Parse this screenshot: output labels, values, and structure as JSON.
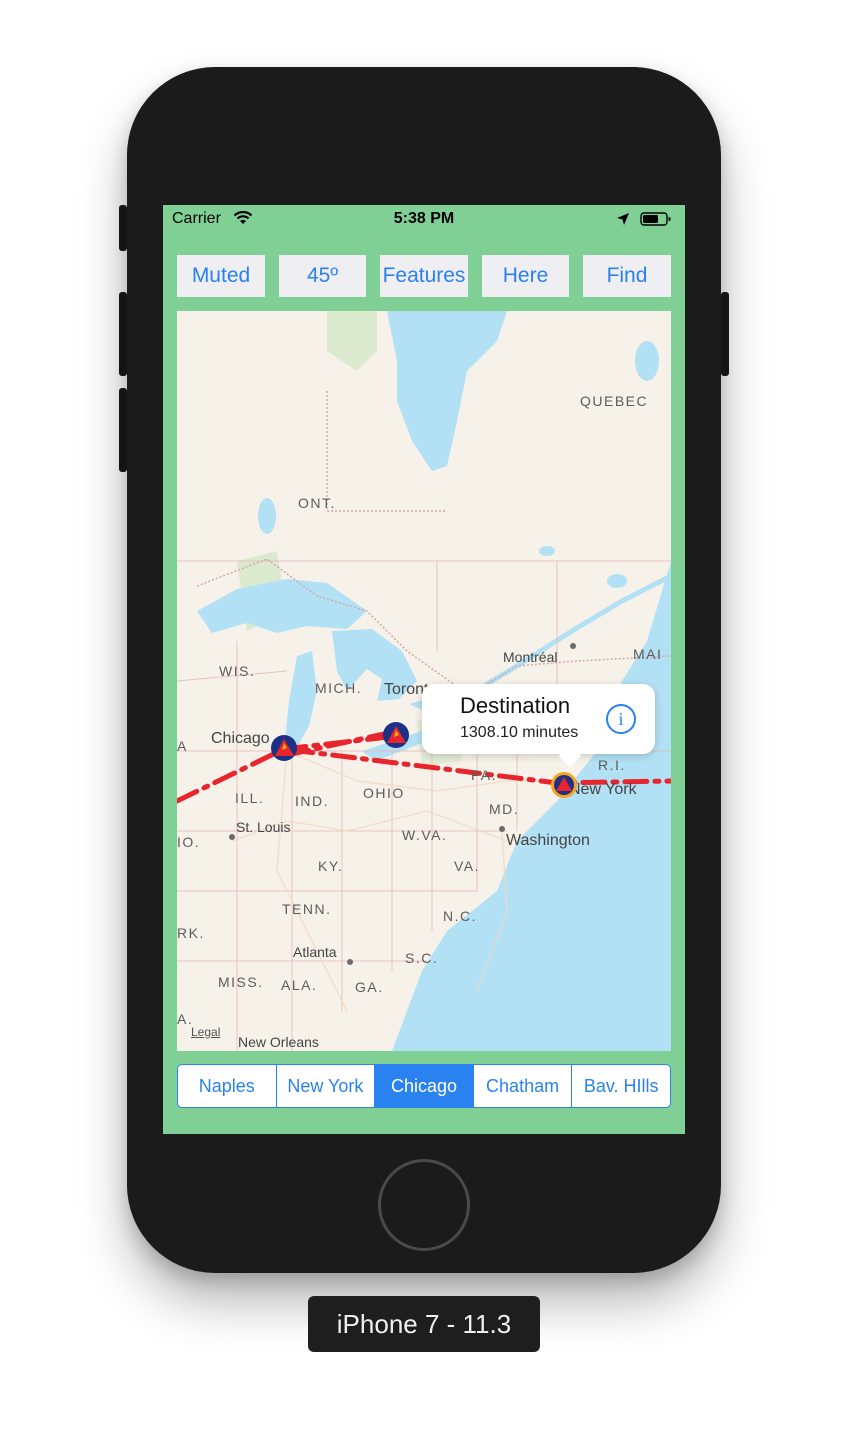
{
  "status_bar": {
    "carrier": "Carrier",
    "time": "5:38 PM"
  },
  "toolbar": {
    "muted": "Muted",
    "angle": "45º",
    "features": "Features",
    "here": "Here",
    "find": "Find"
  },
  "map": {
    "labels": {
      "quebec": "QUEBEC",
      "ont": "ONT.",
      "wis": "WIS.",
      "mich": "MICH.",
      "ill": "ILL.",
      "ind": "IND.",
      "ohio": "OHIO",
      "pa": "PA.",
      "md": "MD.",
      "wva": "W.VA.",
      "va": "VA.",
      "ky": "KY.",
      "tenn": "TENN.",
      "nc": "N.C.",
      "sc": "S.C.",
      "ga": "GA.",
      "ala": "ALA.",
      "miss": "MISS.",
      "ark": "RK.",
      "mo": "IO.",
      "la": "A.",
      "ia": "A",
      "mai": "MAI",
      "ri": "R.I."
    },
    "cities": {
      "chicago": "Chicago",
      "toronto": "Toronto",
      "montreal": "Montréal",
      "new_york": "New York",
      "washington": "Washington",
      "st_louis": "St. Louis",
      "atlanta": "Atlanta",
      "new_orleans": "New Orleans"
    },
    "legal": "Legal",
    "callout": {
      "title": "Destination",
      "subtitle": "1308.10 minutes"
    }
  },
  "segments": {
    "items": [
      "Naples",
      "New York",
      "Chicago",
      "Chatham",
      "Bav. HIlls"
    ],
    "selected": "Chicago"
  },
  "device_label": "iPhone 7 - 11.3",
  "colors": {
    "screen_bg": "#80cf94",
    "accent": "#2a82f0",
    "route": "#e8252c",
    "water": "#b2e0f4",
    "land": "#f6f2ea"
  }
}
